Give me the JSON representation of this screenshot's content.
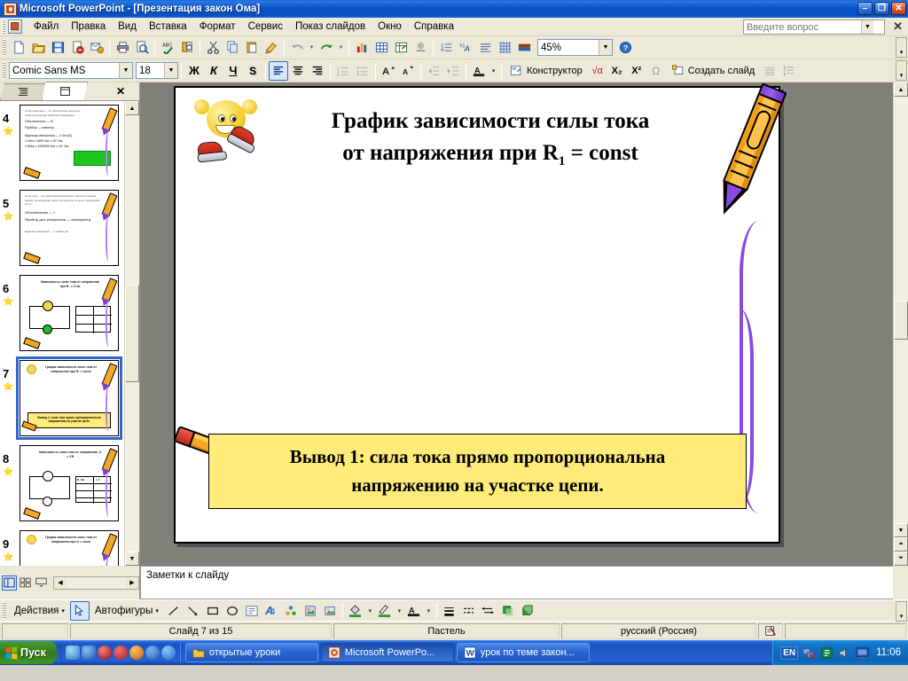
{
  "window": {
    "title": "Microsoft PowerPoint - [Презентация закон Ома]",
    "minimize": "–",
    "restore": "❐",
    "close": "✕"
  },
  "menu": {
    "items": [
      "Файл",
      "Правка",
      "Вид",
      "Вставка",
      "Формат",
      "Сервис",
      "Показ слайдов",
      "Окно",
      "Справка"
    ],
    "ask_placeholder": "Введите вопрос",
    "close_label": "✕"
  },
  "standard_toolbar": {
    "buttons": [
      {
        "name": "new-document",
        "glyph": "🗋"
      },
      {
        "name": "open-file",
        "glyph": "📂"
      },
      {
        "name": "save",
        "glyph": "💾"
      },
      {
        "name": "permission",
        "glyph": "🗎"
      },
      {
        "name": "email",
        "glyph": "✉"
      },
      {
        "name": "print",
        "glyph": "🖨"
      },
      {
        "name": "print-preview",
        "glyph": "🔍"
      },
      {
        "name": "spelling",
        "glyph": "ABC"
      },
      {
        "name": "research",
        "glyph": "📖"
      },
      {
        "name": "cut",
        "glyph": "✂"
      },
      {
        "name": "copy",
        "glyph": "⧉"
      },
      {
        "name": "paste",
        "glyph": "📋"
      },
      {
        "name": "format-painter",
        "glyph": "🖌"
      },
      {
        "name": "undo",
        "glyph": "↶"
      },
      {
        "name": "undo-dropdown",
        "glyph": "▾"
      },
      {
        "name": "redo",
        "glyph": "↷"
      },
      {
        "name": "redo-dropdown",
        "glyph": "▾"
      },
      {
        "name": "insert-chart",
        "glyph": "📊"
      },
      {
        "name": "insert-table",
        "glyph": "▦"
      },
      {
        "name": "insert-spreadsheet",
        "glyph": "🗒"
      },
      {
        "name": "insert-hyperlink",
        "glyph": "🔗"
      },
      {
        "name": "expand-all",
        "glyph": "↓≡"
      },
      {
        "name": "show-formatting",
        "glyph": "½A"
      },
      {
        "name": "show-text-formatting",
        "glyph": "≡"
      },
      {
        "name": "grid-and-guides",
        "glyph": "▦"
      },
      {
        "name": "color-grayscale",
        "glyph": "▬"
      }
    ],
    "zoom_value": "45%",
    "help_glyph": "?"
  },
  "formatting_toolbar": {
    "font_name": "Comic Sans MS",
    "font_size": "18",
    "bold": "Ж",
    "italic": "К",
    "underline": "Ч",
    "shadow": "S",
    "align_left": "≡",
    "align_center": "≡",
    "align_right": "≡",
    "numbering": "⒈",
    "bullets": "•≡",
    "increase_font": "A",
    "decrease_font": "A",
    "decrease_indent": "⇤",
    "increase_indent": "⇥",
    "font_color": "A",
    "font_color_arrow": "▾",
    "design_label": "Конструктор",
    "design_icon": "🗋",
    "formula_label": "√α",
    "subscript_label": "X₂",
    "superscript_label": "X²",
    "symbol_label": "Ω",
    "new_slide_label": "Создать слайд",
    "new_slide_icon": "🗋",
    "align_text": "≡",
    "line_spacing": "↕≡"
  },
  "left_pane": {
    "tab_outline": "≡",
    "tab_slides": "▣",
    "close": "✕",
    "slides": [
      {
        "number": "4",
        "kind": "text",
        "lines": [
          "Сопротивление — это физическая величина, характеризующая свойства проводника.",
          "Обозначение — R.",
          "Прибор — омметр.",
          "Единица измерения — 1 Ом (Ω).",
          "1 кОм = 1000 Ом = 10³ Ом;",
          "1 МОм = 1000000 Ом = 10⁶ Ом"
        ],
        "has_green_box": true
      },
      {
        "number": "5",
        "kind": "text",
        "lines": [
          "Сила тока — это физическая величина, численно равная заряду, прошедшему через поперечное сечение проводника за 1 с.",
          "Обозначение — I.",
          "Прибор для измерения — амперметр.",
          "Единица измерения — 1 ампер (А)."
        ],
        "has_green_box": false
      },
      {
        "number": "6",
        "kind": "circuit",
        "title": "Зависимость силы тока от напряжения при R₁ = 2 Ом",
        "has_table": true
      },
      {
        "number": "7",
        "kind": "graph",
        "selected": true,
        "title": "График зависимости силы тока от напряжения при R₁ = const",
        "callout": "Вывод 1: сила тока прямо пропорциональна напряжению на участке цепи."
      },
      {
        "number": "8",
        "kind": "circuit",
        "title": "Зависимость силы тока от напряжения, U = 3 В",
        "table_headers": [
          "R, Ом",
          "I, А"
        ],
        "has_table": true
      },
      {
        "number": "9",
        "kind": "graph",
        "title": "График зависимости силы тока от напряжения при U = const"
      }
    ]
  },
  "slide": {
    "title_line1": "График зависимости силы тока",
    "title_line2_a": "от напряжения при R",
    "title_line2_sub": "1",
    "title_line2_b": " = const",
    "conclusion_line1": "Вывод 1: сила тока прямо пропорциональна",
    "conclusion_line2": "напряжению на участке цепи.",
    "conclusion_bg": "#ffeb7a",
    "crayon_body_color": "#f5a623",
    "crayon_tip_color": "#8a4ae0",
    "squiggle_color": "#8a4ae0",
    "pencil_body_color": "#f5a623",
    "pencil_end_color": "#d4281a",
    "mascot_color": "#f3cf31"
  },
  "notes": {
    "placeholder": "Заметки к слайду"
  },
  "view_buttons": {
    "normal": "▤",
    "slide_sorter": "▦",
    "slide_show": "▽"
  },
  "drawing_toolbar": {
    "actions_label": "Действия",
    "actions_arrow": "▾",
    "select_glyph": "↖",
    "autoshapes_label": "Автофигуры",
    "autoshapes_arrow": "▾",
    "line": "╲",
    "arrow": "↘",
    "rectangle": "▭",
    "oval": "◯",
    "textbox": "▤",
    "wordart": "A",
    "diagram": "◔",
    "clipart": "🖼",
    "picture": "🖼",
    "fill_color": "▱",
    "fill_arrow": "▾",
    "line_color": "🖌",
    "line_arrow": "▾",
    "font_color": "A",
    "font_arrow": "▾",
    "line_style": "≡",
    "dash_style": "┈",
    "arrow_style": "⇄",
    "shadow_style": "▢",
    "3d_style": "▣"
  },
  "status_bar": {
    "slide_counter": "Слайд 7 из 15",
    "design_template": "Пастель",
    "language": "русский (Россия)",
    "spellcheck_icon": "📖"
  },
  "taskbar": {
    "start_label": "Пуск",
    "quick_launch": [
      {
        "name": "show-desktop-icon",
        "color": "#6ab0e8"
      },
      {
        "name": "internet-explorer-icon",
        "color": "#3b7fd4"
      },
      {
        "name": "media-player-icon",
        "color": "#b02020"
      },
      {
        "name": "opera-icon",
        "color": "#d43030"
      },
      {
        "name": "firefox-icon",
        "color": "#e88020"
      },
      {
        "name": "ie-icon-2",
        "color": "#2a6fd0"
      },
      {
        "name": "browser-icon",
        "color": "#3b8ad8"
      }
    ],
    "windows": [
      {
        "label": "открытые уроки",
        "icon": "folder",
        "active": false
      },
      {
        "label": "Microsoft PowerPo...",
        "icon": "powerpoint",
        "active": true
      },
      {
        "label": "урок по теме закон...",
        "icon": "word",
        "active": false
      }
    ],
    "tray": {
      "language": "EN",
      "icons": [
        "network-icon",
        "clipboard-icon",
        "volume-icon",
        "display-icon"
      ],
      "clock": "11:06"
    }
  }
}
